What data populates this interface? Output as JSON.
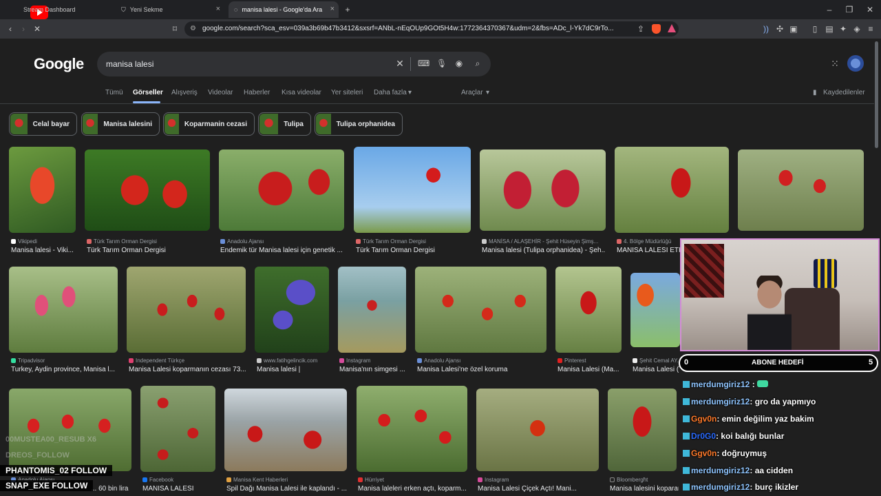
{
  "browser": {
    "tabs": [
      {
        "label": "Stream Dashboard",
        "active": false
      },
      {
        "label": "Yeni Sekme",
        "active": false
      },
      {
        "label": "manisa lalesi - Google'da Ara",
        "active": true
      }
    ],
    "url": "google.com/search?sca_esv=039a3b69b47b3412&sxsrf=ANbL-nEqOUp9GOt5H4w:1772364370367&udm=2&fbs=ADc_l-Yk7dC9rTo..."
  },
  "google": {
    "logo": "Google",
    "query": "manisa lalesi",
    "tabs": [
      "Tümü",
      "Görseller",
      "Alışveriş",
      "Videolar",
      "Haberler",
      "Kısa videolar",
      "Yer siteleri",
      "Daha fazla"
    ],
    "tools": "Araçlar",
    "saved": "Kaydedilenler",
    "chips": [
      "Celal bayar",
      "Manisa lalesini",
      "Koparmanin cezasi",
      "Tulipa",
      "Tulipa orphanidea"
    ],
    "results": [
      {
        "source": "Vikipedi",
        "title": "Manisa lalesi - Viki..."
      },
      {
        "source": "Türk Tarım Orman Dergisi",
        "title": "Türk Tarım Orman Dergisi"
      },
      {
        "source": "Anadolu Ajansı",
        "title": "Endemik tür Manisa lalesi için genetik ..."
      },
      {
        "source": "Türk Tarım Orman Dergisi",
        "title": "Türk Tarım Orman Dergisi"
      },
      {
        "source": "MANİSA / ALAŞEHİR - Şehit Hüseyin Şimş...",
        "title": "Manisa lalesi (Tulipa orphanidea) - Şeh..."
      },
      {
        "source": "4. Bölge Müdürlüğü",
        "title": "MANİSA LALESİ ETK..."
      },
      {
        "source": "Tripadvisor",
        "title": "Turkey, Aydin province, Manisa l..."
      },
      {
        "source": "Independent Türkçe",
        "title": "Manisa Lalesi koparmanın cezası 73..."
      },
      {
        "source": "www.fatihgelincik.com",
        "title": "Manisa lalesi |"
      },
      {
        "source": "Instagram",
        "title": "Manisa'nın simgesi ..."
      },
      {
        "source": "Anadolu Ajansı",
        "title": "Manisa Lalesi'ne özel koruma"
      },
      {
        "source": "Pinterest",
        "title": "Manisa Lalesi (Ma..."
      },
      {
        "source": "Şehit Cemal AY...",
        "title": "Manisa Lalesi (T..."
      },
      {
        "source": "Anadolu Ajansı",
        "title": "... 60 bin lira"
      },
      {
        "source": "Facebook",
        "title": "MANİSA LALESİ"
      },
      {
        "source": "Manisa Kent Haberleri",
        "title": "Spil Dağı Manisa Lalesi ile kaplandı - ..."
      },
      {
        "source": "Hürriyet",
        "title": "Manisa laleleri erken açtı, koparm..."
      },
      {
        "source": "Instagram",
        "title": "Manisa Lalesi Çiçek Açtı! Mani..."
      },
      {
        "source": "Bloombergħt",
        "title": "Manisa lalesini koparana..."
      }
    ]
  },
  "overlay": {
    "abone_label": "ABONE HEDEFİ",
    "abone_current": "0",
    "abone_target": "5",
    "chat": [
      {
        "user": "merdumgiriz12",
        "msg": ":"
      },
      {
        "user": "merdumgiriz12",
        "msg": ": gro da yapmıyo"
      },
      {
        "user": "Ggv0n",
        "msg": ": emin değilim yaz bakim"
      },
      {
        "user": "Dr0G0",
        "msg": ": koi balığı bunlar"
      },
      {
        "user": "Ggv0n",
        "msg": ": doğruymuş"
      },
      {
        "user": "merdumgiriz12",
        "msg": ": aa cidden"
      },
      {
        "user": "merdumgiriz12",
        "msg": ": burç ikizler"
      }
    ],
    "ghost_events": [
      "00MUSTEA00_RESUB X6",
      "DREOS_FOLLOW"
    ],
    "events": [
      "PHANTOMIS_02  FOLLOW",
      "SNAP_EXE  FOLLOW"
    ]
  },
  "colors": {
    "accent": "#8ab4f8",
    "webcam_border": "#d58bd8"
  }
}
